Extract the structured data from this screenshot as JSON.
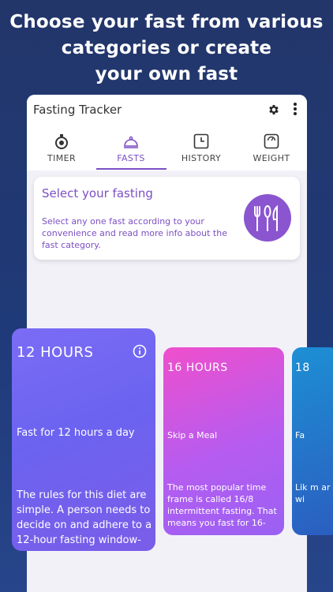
{
  "headline": {
    "line1": "Choose your fast from various",
    "line2": "categories or create",
    "line3": "your own fast"
  },
  "app": {
    "title": "Fasting Tracker",
    "accent": "#7b4fc4"
  },
  "tabs": [
    {
      "label": "TIMER",
      "icon": "stopwatch-icon"
    },
    {
      "label": "FASTS",
      "icon": "cloche-icon",
      "active": true
    },
    {
      "label": "HISTORY",
      "icon": "clock-icon"
    },
    {
      "label": "WEIGHT",
      "icon": "scale-icon"
    }
  ],
  "select_card": {
    "title": "Select your fasting",
    "desc": "Select any one fast according to your convenience and read more info about the fast category.",
    "icon": "cutlery-icon"
  },
  "fasts": [
    {
      "hours": "12 HOURS",
      "subtitle": "Fast for 12 hours a day",
      "desc": "The rules for this diet are simple. A person needs to decide on and adhere to a 12-hour fasting window-"
    },
    {
      "hours": "16 HOURS",
      "subtitle": "Skip a Meal",
      "desc": "The most popular time frame is called 16/8 intermittent fasting. That means you fast for 16-"
    },
    {
      "hours": "18",
      "subtitle": "Fa",
      "desc": "Lik m ar wi"
    }
  ]
}
